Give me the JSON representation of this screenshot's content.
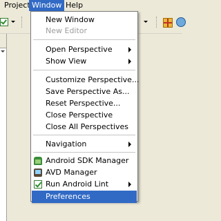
{
  "menubar": {
    "items": [
      {
        "label": "Project"
      },
      {
        "label": "Window"
      },
      {
        "label": "Help"
      }
    ]
  },
  "window_menu": {
    "items": [
      {
        "label": "New Window",
        "enabled": true
      },
      {
        "label": "New Editor",
        "enabled": false
      },
      {
        "label": "Open Perspective",
        "submenu": true
      },
      {
        "label": "Show View",
        "submenu": true
      },
      {
        "label": "Customize Perspective..."
      },
      {
        "label": "Save Perspective As..."
      },
      {
        "label": "Reset Perspective..."
      },
      {
        "label": "Close Perspective"
      },
      {
        "label": "Close All Perspectives"
      },
      {
        "label": "Navigation",
        "submenu": true
      },
      {
        "label": "Android SDK Manager",
        "icon": "android-sdk-icon"
      },
      {
        "label": "AVD Manager",
        "icon": "avd-icon"
      },
      {
        "label": "Run Android Lint",
        "icon": "lint-check-icon",
        "submenu": true
      },
      {
        "label": "Preferences",
        "selected": true
      }
    ]
  },
  "colors": {
    "selection": "#316ac5",
    "menubar_bg": "#ece9d8",
    "disabled_text": "#9c9c9c"
  }
}
